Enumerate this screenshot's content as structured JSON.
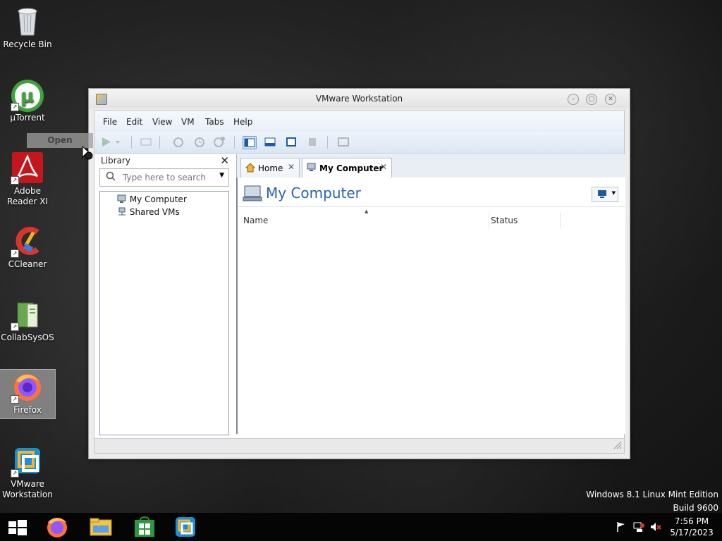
{
  "desktop": {
    "icons": [
      {
        "label": "Recycle Bin",
        "icon": "recycle-bin-icon"
      },
      {
        "label": "µTorrent",
        "icon": "utorrent-icon"
      },
      {
        "label": "Adobe Reader XI",
        "icon": "adobe-reader-icon"
      },
      {
        "label": "CCleaner",
        "icon": "ccleaner-icon"
      },
      {
        "label": "CollabSysOS",
        "icon": "collabsysos-icon"
      },
      {
        "label": "Firefox",
        "icon": "firefox-icon"
      },
      {
        "label": "VMware Workstation",
        "icon": "vmware-icon"
      }
    ],
    "watermark_line1": "Windows 8.1 Linux Mint Edition",
    "watermark_line2": "Build 9600"
  },
  "drag_tooltip": {
    "label": "Open"
  },
  "window": {
    "title": "VMware Workstation",
    "menu": [
      "File",
      "Edit",
      "View",
      "VM",
      "Tabs",
      "Help"
    ],
    "library": {
      "title": "Library",
      "search_placeholder": "Type here to search",
      "items": [
        "My Computer",
        "Shared VMs"
      ]
    },
    "tabs": [
      {
        "label": "Home",
        "icon": "home-icon"
      },
      {
        "label": "My Computer",
        "icon": "computer-icon"
      }
    ],
    "content": {
      "title": "My Computer",
      "columns": [
        "Name",
        "Status"
      ]
    }
  },
  "taskbar": {
    "clock_time": "7:56 PM",
    "clock_date": "5/17/2023",
    "pinned": [
      "start-icon",
      "firefox-icon",
      "file-explorer-icon",
      "store-icon",
      "vmware-icon"
    ],
    "tray": [
      "flag-icon",
      "network-icon",
      "volume-muted-icon"
    ]
  }
}
